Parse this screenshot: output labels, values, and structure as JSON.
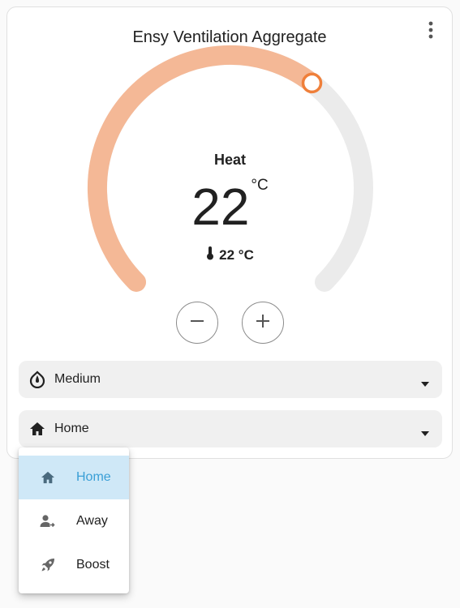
{
  "card": {
    "title": "Ensy Ventilation Aggregate",
    "menu_icon": "dots-vertical-icon"
  },
  "thermostat": {
    "mode": "Heat",
    "target_temperature": "22",
    "target_unit": "°C",
    "current_temperature": "22 °C",
    "current_icon": "thermometer-icon",
    "setpoint_fraction": 0.64,
    "accent_color": "#f4b896",
    "handle_color": "#ef7f3a",
    "track_color": "#ebebeb",
    "decrease_icon": "minus-icon",
    "increase_icon": "plus-icon"
  },
  "fan_mode_select": {
    "icon": "fan-speed-icon",
    "value": "Medium"
  },
  "preset_select": {
    "icon": "home-icon",
    "value": "Home"
  },
  "preset_dropdown": {
    "options": [
      {
        "label": "Home",
        "icon": "home-icon",
        "selected": true
      },
      {
        "label": "Away",
        "icon": "account-arrow-right-icon",
        "selected": false
      },
      {
        "label": "Boost",
        "icon": "rocket-icon",
        "selected": false
      }
    ],
    "selected_bg": "#cfe8f7",
    "selected_text_color": "#3a9fd6"
  }
}
